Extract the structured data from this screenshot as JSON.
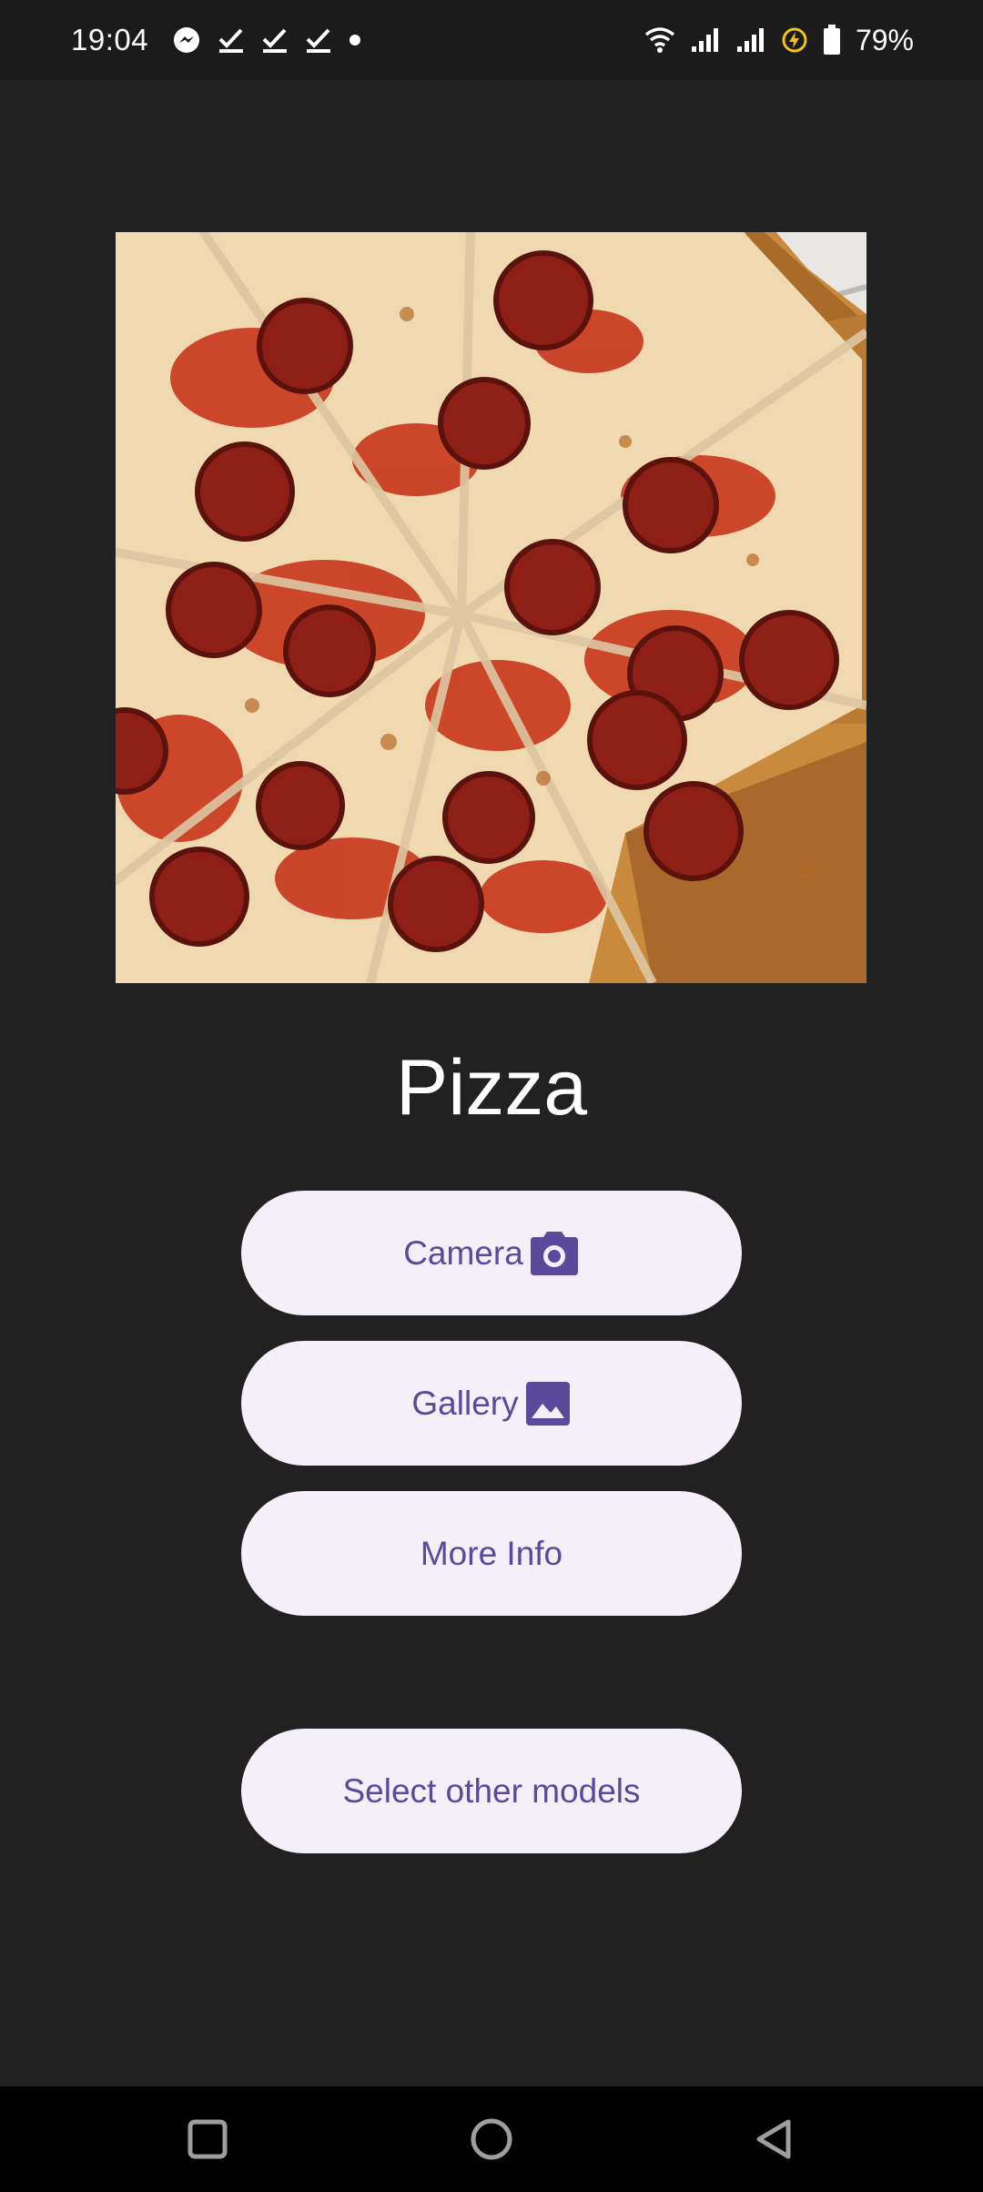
{
  "status_bar": {
    "time": "19:04",
    "battery_percent": "79%",
    "left_icons": [
      "messenger-icon",
      "checkmark-icon",
      "checkmark-icon",
      "checkmark-icon",
      "dot-icon"
    ],
    "right_icons": [
      "wifi-icon",
      "signal-icon",
      "signal-icon",
      "battery-saver-icon",
      "battery-icon"
    ]
  },
  "main": {
    "image_alt": "pepperoni pizza",
    "result_label": "Pizza",
    "buttons": {
      "camera": {
        "label": "Camera",
        "icon": "camera-icon"
      },
      "gallery": {
        "label": "Gallery",
        "icon": "image-icon"
      },
      "more_info": {
        "label": "More Info"
      },
      "select_models": {
        "label": "Select other models"
      }
    }
  },
  "nav_bar": {
    "items": [
      "recents",
      "home",
      "back"
    ]
  },
  "colors": {
    "background": "#212121",
    "button_bg": "#f4eff8",
    "button_text": "#5a4a9c",
    "accent_yellow": "#f2c21b"
  }
}
